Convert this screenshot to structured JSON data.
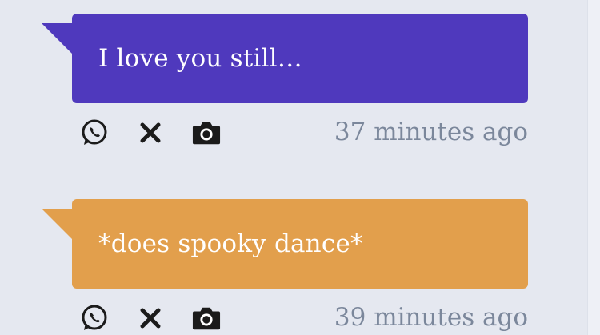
{
  "messages": [
    {
      "text": "I love you still…",
      "time": "37 minutes ago",
      "color": "#4f39bd"
    },
    {
      "text": "*does spooky dance*",
      "time": "39 minutes ago",
      "color": "#e29f4c"
    }
  ],
  "icons": [
    "whatsapp-icon",
    "close-icon",
    "camera-icon"
  ]
}
